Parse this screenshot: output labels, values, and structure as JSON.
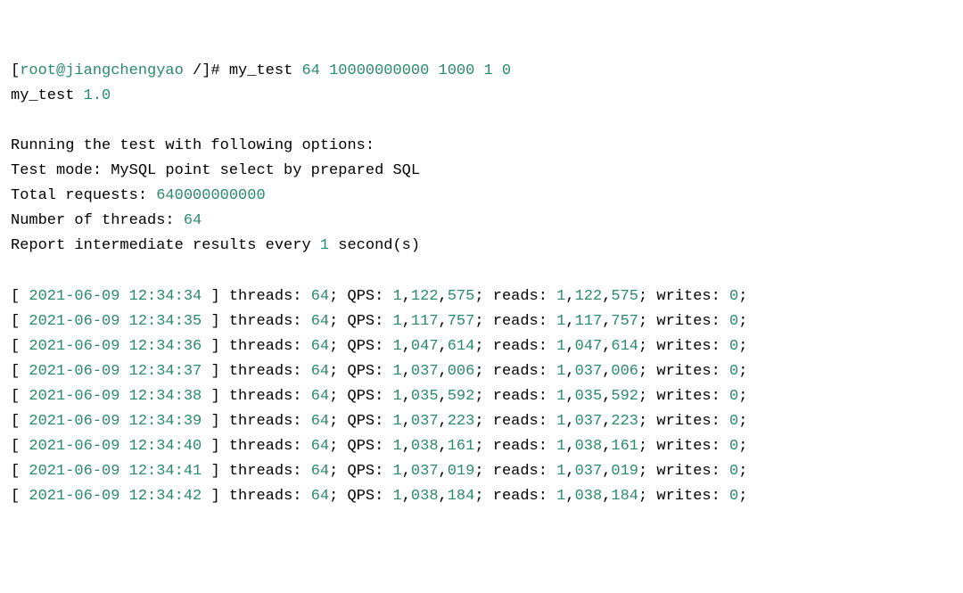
{
  "prompt": {
    "open": "[",
    "userhost": "root@jiangchengyao ",
    "path": "/",
    "close": "]# ",
    "cmd": "my_test ",
    "args": "64 10000000000 1000 1 0"
  },
  "name_line": {
    "name": "my_test ",
    "version": "1.0"
  },
  "header": {
    "running": "Running the test with following options:",
    "mode": "Test mode: MySQL point select by prepared SQL",
    "requests_label": "Total requests: ",
    "requests_value": "640000000000",
    "threads_label": "Number of threads: ",
    "threads_value": "64",
    "interval_prefix": "Report intermediate results every ",
    "interval_value": "1",
    "interval_suffix": " second(s)"
  },
  "rows": [
    {
      "open": "[ ",
      "ts": "2021-06-09 12:34:34",
      "close": " ]",
      "threads_l": " threads: ",
      "threads_v": "64",
      "s1": "; QPS: ",
      "qps1": "1",
      "qc1": ",",
      "qps2": "122",
      "qc2": ",",
      "qps3": "575",
      "s2": "; reads: ",
      "rd1": "1",
      "rc1": ",",
      "rd2": "122",
      "rc2": ",",
      "rd3": "575",
      "s3": "; writes: ",
      "wr": "0",
      "end": ";"
    },
    {
      "open": "[ ",
      "ts": "2021-06-09 12:34:35",
      "close": " ]",
      "threads_l": " threads: ",
      "threads_v": "64",
      "s1": "; QPS: ",
      "qps1": "1",
      "qc1": ",",
      "qps2": "117",
      "qc2": ",",
      "qps3": "757",
      "s2": "; reads: ",
      "rd1": "1",
      "rc1": ",",
      "rd2": "117",
      "rc2": ",",
      "rd3": "757",
      "s3": "; writes: ",
      "wr": "0",
      "end": ";"
    },
    {
      "open": "[ ",
      "ts": "2021-06-09 12:34:36",
      "close": " ]",
      "threads_l": " threads: ",
      "threads_v": "64",
      "s1": "; QPS: ",
      "qps1": "1",
      "qc1": ",",
      "qps2": "047",
      "qc2": ",",
      "qps3": "614",
      "s2": "; reads: ",
      "rd1": "1",
      "rc1": ",",
      "rd2": "047",
      "rc2": ",",
      "rd3": "614",
      "s3": "; writes: ",
      "wr": "0",
      "end": ";"
    },
    {
      "open": "[ ",
      "ts": "2021-06-09 12:34:37",
      "close": " ]",
      "threads_l": " threads: ",
      "threads_v": "64",
      "s1": "; QPS: ",
      "qps1": "1",
      "qc1": ",",
      "qps2": "037",
      "qc2": ",",
      "qps3": "006",
      "s2": "; reads: ",
      "rd1": "1",
      "rc1": ",",
      "rd2": "037",
      "rc2": ",",
      "rd3": "006",
      "s3": "; writes: ",
      "wr": "0",
      "end": ";"
    },
    {
      "open": "[ ",
      "ts": "2021-06-09 12:34:38",
      "close": " ]",
      "threads_l": " threads: ",
      "threads_v": "64",
      "s1": "; QPS: ",
      "qps1": "1",
      "qc1": ",",
      "qps2": "035",
      "qc2": ",",
      "qps3": "592",
      "s2": "; reads: ",
      "rd1": "1",
      "rc1": ",",
      "rd2": "035",
      "rc2": ",",
      "rd3": "592",
      "s3": "; writes: ",
      "wr": "0",
      "end": ";"
    },
    {
      "open": "[ ",
      "ts": "2021-06-09 12:34:39",
      "close": " ]",
      "threads_l": " threads: ",
      "threads_v": "64",
      "s1": "; QPS: ",
      "qps1": "1",
      "qc1": ",",
      "qps2": "037",
      "qc2": ",",
      "qps3": "223",
      "s2": "; reads: ",
      "rd1": "1",
      "rc1": ",",
      "rd2": "037",
      "rc2": ",",
      "rd3": "223",
      "s3": "; writes: ",
      "wr": "0",
      "end": ";"
    },
    {
      "open": "[ ",
      "ts": "2021-06-09 12:34:40",
      "close": " ]",
      "threads_l": " threads: ",
      "threads_v": "64",
      "s1": "; QPS: ",
      "qps1": "1",
      "qc1": ",",
      "qps2": "038",
      "qc2": ",",
      "qps3": "161",
      "s2": "; reads: ",
      "rd1": "1",
      "rc1": ",",
      "rd2": "038",
      "rc2": ",",
      "rd3": "161",
      "s3": "; writes: ",
      "wr": "0",
      "end": ";"
    },
    {
      "open": "[ ",
      "ts": "2021-06-09 12:34:41",
      "close": " ]",
      "threads_l": " threads: ",
      "threads_v": "64",
      "s1": "; QPS: ",
      "qps1": "1",
      "qc1": ",",
      "qps2": "037",
      "qc2": ",",
      "qps3": "019",
      "s2": "; reads: ",
      "rd1": "1",
      "rc1": ",",
      "rd2": "037",
      "rc2": ",",
      "rd3": "019",
      "s3": "; writes: ",
      "wr": "0",
      "end": ";"
    },
    {
      "open": "[ ",
      "ts": "2021-06-09 12:34:42",
      "close": " ]",
      "threads_l": " threads: ",
      "threads_v": "64",
      "s1": "; QPS: ",
      "qps1": "1",
      "qc1": ",",
      "qps2": "038",
      "qc2": ",",
      "qps3": "184",
      "s2": "; reads: ",
      "rd1": "1",
      "rc1": ",",
      "rd2": "038",
      "rc2": ",",
      "rd3": "184",
      "s3": "; writes: ",
      "wr": "0",
      "end": ";"
    }
  ]
}
